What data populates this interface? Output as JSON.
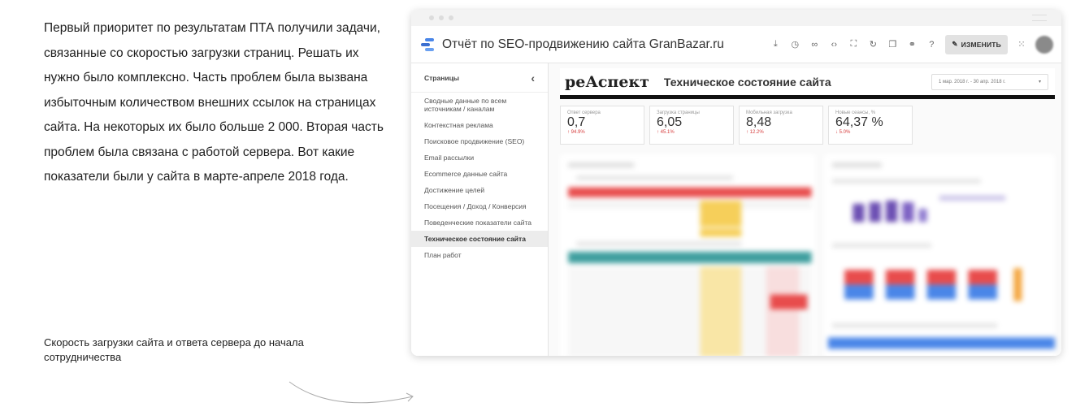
{
  "article": {
    "paragraph": "Первый приоритет по результатам ПТА получили задачи, связанные со скоростью загрузки страниц. Решать их нужно было комплексно. Часть проблем была вызвана избыточным количеством внешних ссылок на страницах сайта. На некоторых их было больше 2 000. Вторая часть проблем была связана с работой сервера. Вот какие показатели были у сайта в марте-апреле 2018 года.",
    "caption": "Скорость загрузки сайта и ответа сервера до начала сотрудничества"
  },
  "app": {
    "title": "Отчёт по SEO-продвижению сайта GranBazar.ru",
    "edit_label": "ИЗМЕНИТЬ",
    "toolbar_icons": [
      "download-icon",
      "history-icon",
      "link-icon",
      "embed-icon",
      "fullscreen-icon",
      "refresh-icon",
      "copy-icon",
      "share-icon",
      "help-icon"
    ]
  },
  "sidebar": {
    "heading": "Страницы",
    "collapse_glyph": "‹",
    "items": [
      {
        "label": "Сводные данные по всем источникам / каналам",
        "active": false
      },
      {
        "label": "Контекстная реклама",
        "active": false
      },
      {
        "label": "Поисковое продвижение (SEO)",
        "active": false
      },
      {
        "label": "Email рассылки",
        "active": false
      },
      {
        "label": "Ecommerce данные сайта",
        "active": false
      },
      {
        "label": "Достижение целей",
        "active": false
      },
      {
        "label": "Посещения / Доход / Конверсия",
        "active": false
      },
      {
        "label": "Поведенческие показатели сайта",
        "active": false
      },
      {
        "label": "Техническое состояние сайта",
        "active": true
      },
      {
        "label": "План работ",
        "active": false
      }
    ]
  },
  "report": {
    "logo": "реАспект",
    "title": "Техническое состояние сайта",
    "date_range": "1 мар. 2018 г. - 30 апр. 2018 г.",
    "kpis": [
      {
        "label": "Ответ сервера",
        "value": "0,7",
        "delta": "↑ 94.9%"
      },
      {
        "label": "Загрузка страницы",
        "value": "6,05",
        "delta": "↑ 45.1%"
      },
      {
        "label": "Мобильная загрузка",
        "value": "8,48",
        "delta": "↑ 12.2%"
      },
      {
        "label": "Новые сеансы, %",
        "value": "64,37 %",
        "delta": "↓ 5.0%"
      }
    ]
  },
  "colors": {
    "accent_blue": "#4a86e8",
    "red_header": "#e84c4c",
    "teal_header": "#3f9f9f",
    "yellow_cell": "#f6cf5a",
    "purple": "#6c4fb3"
  }
}
